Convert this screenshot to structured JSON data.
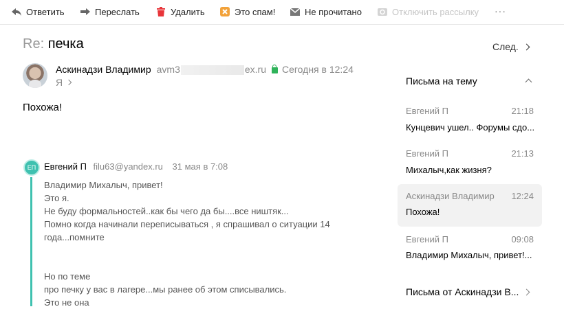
{
  "toolbar": {
    "reply": "Ответить",
    "forward": "Переслать",
    "delete": "Удалить",
    "spam": "Это спам!",
    "unread": "Не прочитано",
    "unsubscribe": "Отключить рассылку",
    "more": "···"
  },
  "message": {
    "subject_prefix": "Re:",
    "subject": "печка",
    "next_label": "След.",
    "sender_name": "Аскинадзи Владимир",
    "sender_email_start": "avm3",
    "sender_email_end": "ex.ru",
    "date": "Сегодня в 12:24",
    "to": "Я",
    "body": "Похожа!"
  },
  "quoted": {
    "initials": "ЕП",
    "name": "Евгений П",
    "email": "filu63@yandex.ru",
    "date": "31 мая в 7:08",
    "lines_a": [
      "Владимир Михалыч, привет!",
      "Это я.",
      "Не буду формальностей..как бы чего да бы....все ништяк...",
      "Помно когда начинали переписываться , я спрашивал о ситуации 14",
      "года...помните"
    ],
    "lines_b": [
      "Но по теме",
      "про печку у вас в лагере...мы ранее об этом списывались.",
      "Это не она"
    ]
  },
  "thread": {
    "title": "Письма на тему",
    "items": [
      {
        "from": "Евгений П",
        "time": "21:18",
        "snippet": "Кунцевич ушел.. Форумы сдо..."
      },
      {
        "from": "Евгений П",
        "time": "21:13",
        "snippet": "Михалыч,как жизня?"
      },
      {
        "from": "Аскинадзи Владимир",
        "time": "12:24",
        "snippet": "Похожа!"
      },
      {
        "from": "Евгений П",
        "time": "09:08",
        "snippet": "Владимир Михалыч, привет!..."
      }
    ],
    "from_sender": "Письма от Аскинадзи В..."
  },
  "colors": {
    "accent": "#3fc1b0",
    "delete_red": "#e8353a",
    "spam_orange": "#f2a23a",
    "lock_green": "#2fb35a"
  }
}
